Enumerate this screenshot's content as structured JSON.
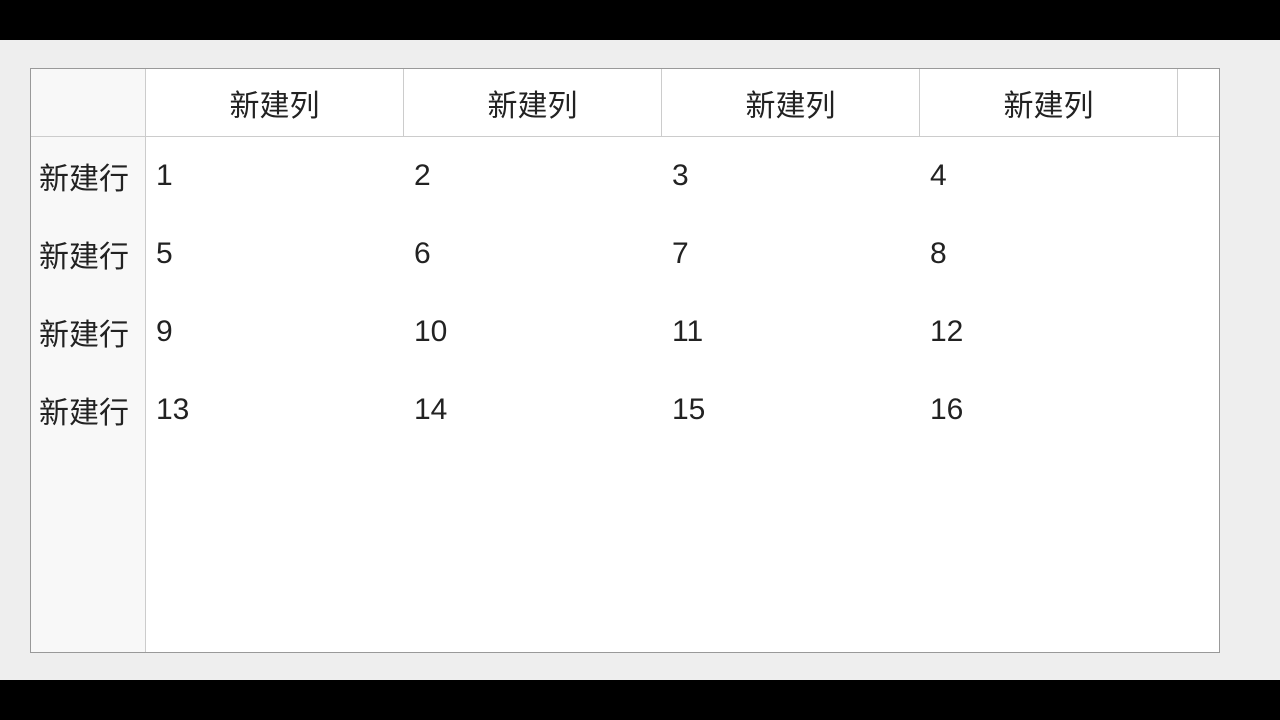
{
  "table": {
    "columns": [
      "新建列",
      "新建列",
      "新建列",
      "新建列"
    ],
    "rows": [
      {
        "label": "新建行",
        "values": [
          "1",
          "2",
          "3",
          "4"
        ]
      },
      {
        "label": "新建行",
        "values": [
          "5",
          "6",
          "7",
          "8"
        ]
      },
      {
        "label": "新建行",
        "values": [
          "9",
          "10",
          "11",
          "12"
        ]
      },
      {
        "label": "新建行",
        "values": [
          "13",
          "14",
          "15",
          "16"
        ]
      }
    ]
  }
}
